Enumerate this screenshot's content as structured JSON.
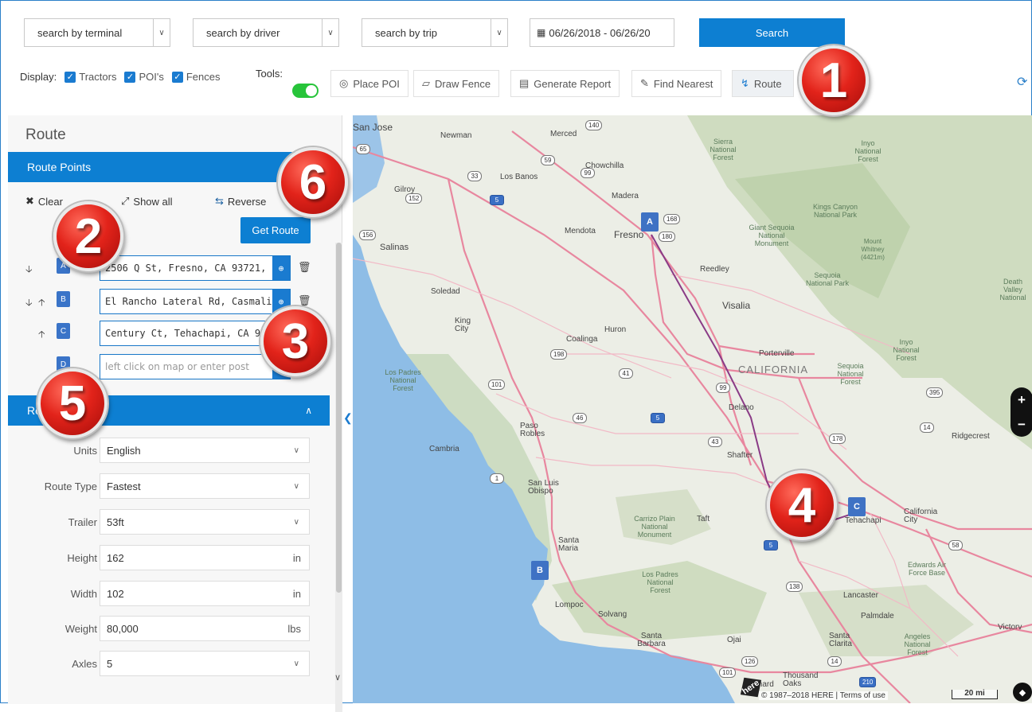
{
  "filters": {
    "terminal_placeholder": "search by terminal",
    "driver_placeholder": "search by driver",
    "trip_placeholder": "search by trip",
    "date_range": "06/26/2018 - 06/26/20",
    "search_label": "Search"
  },
  "display": {
    "label": "Display:",
    "tractors": "Tractors",
    "pois": "POI's",
    "fences": "Fences"
  },
  "tools": {
    "label": "Tools:",
    "place_poi": "Place POI",
    "draw_fence": "Draw Fence",
    "generate_report": "Generate Report",
    "find_nearest": "Find Nearest",
    "route": "Route"
  },
  "sidebar": {
    "title": "Route",
    "route_points_header": "Route Points",
    "clear_label": "Clear",
    "show_all_label": "Show all",
    "reverse_label": "Reverse",
    "get_route_label": "Get Route",
    "points": [
      {
        "letter": "A",
        "value": "2506 Q St, Fresno, CA 93721,"
      },
      {
        "letter": "B",
        "value": "El Rancho Lateral Rd, Casmali"
      },
      {
        "letter": "C",
        "value": "Century Ct, Tehachapi, CA 93"
      },
      {
        "letter": "D",
        "placeholder": "left click on map or enter post"
      }
    ],
    "options_header": "Route Options",
    "options": [
      {
        "label": "Units",
        "value": "English",
        "kind": "select"
      },
      {
        "label": "Route Type",
        "value": "Fastest",
        "kind": "select"
      },
      {
        "label": "Trailer",
        "value": "53ft",
        "kind": "select"
      },
      {
        "label": "Height",
        "value": "162",
        "unit": "in"
      },
      {
        "label": "Width",
        "value": "102",
        "unit": "in"
      },
      {
        "label": "Weight",
        "value": "80,000",
        "unit": "lbs"
      },
      {
        "label": "Axles",
        "value": "5",
        "kind": "select"
      }
    ]
  },
  "map": {
    "state_label": "CALIFORNIA",
    "markers": [
      "A",
      "B",
      "C"
    ],
    "scale": "20 mi",
    "copyright": "© 1987–2018 HERE | Terms of use",
    "logo": "here",
    "cities": [
      "San Jose",
      "Newman",
      "Merced",
      "Chowchilla",
      "Los Banos",
      "Gilroy",
      "Madera",
      "Mendota",
      "Fresno",
      "Salinas",
      "Reedley",
      "Soledad",
      "Visalia",
      "King City",
      "Huron",
      "Coalinga",
      "Porterville",
      "Delano",
      "Paso Robles",
      "Cambria",
      "Shafter",
      "San Luis Obispo",
      "Taft",
      "Tehachapi",
      "California City",
      "Ridgecrest",
      "Santa Maria",
      "Lompoc",
      "Solvang",
      "Lancaster",
      "Palmdale",
      "Santa Barbara",
      "Ojai",
      "Santa Clarita",
      "Thousand Oaks",
      "Oxnard",
      "Victorv"
    ],
    "parks": [
      "Sierra National Forest",
      "Inyo National Forest",
      "Kings Canyon National Park",
      "Giant Sequoia National Monument",
      "Sequoia National Park",
      "Inyo National Forest",
      "Sequoia National Forest",
      "Los Padres National Forest",
      "Carrizo Plain National Monument",
      "Los Padres National Forest",
      "Angeles National Forest",
      "Edwards Air Force Base",
      "Death Valley National"
    ],
    "peak": "Mount Whitney (4421m)",
    "highways": [
      "140",
      "65",
      "59",
      "152",
      "33",
      "99",
      "5",
      "168",
      "180",
      "156",
      "198",
      "41",
      "101",
      "99",
      "46",
      "5",
      "43",
      "178",
      "395",
      "14",
      "58",
      "1",
      "5",
      "138",
      "126",
      "101",
      "14",
      "210"
    ]
  },
  "callouts": [
    "1",
    "2",
    "3",
    "4",
    "5",
    "6"
  ]
}
